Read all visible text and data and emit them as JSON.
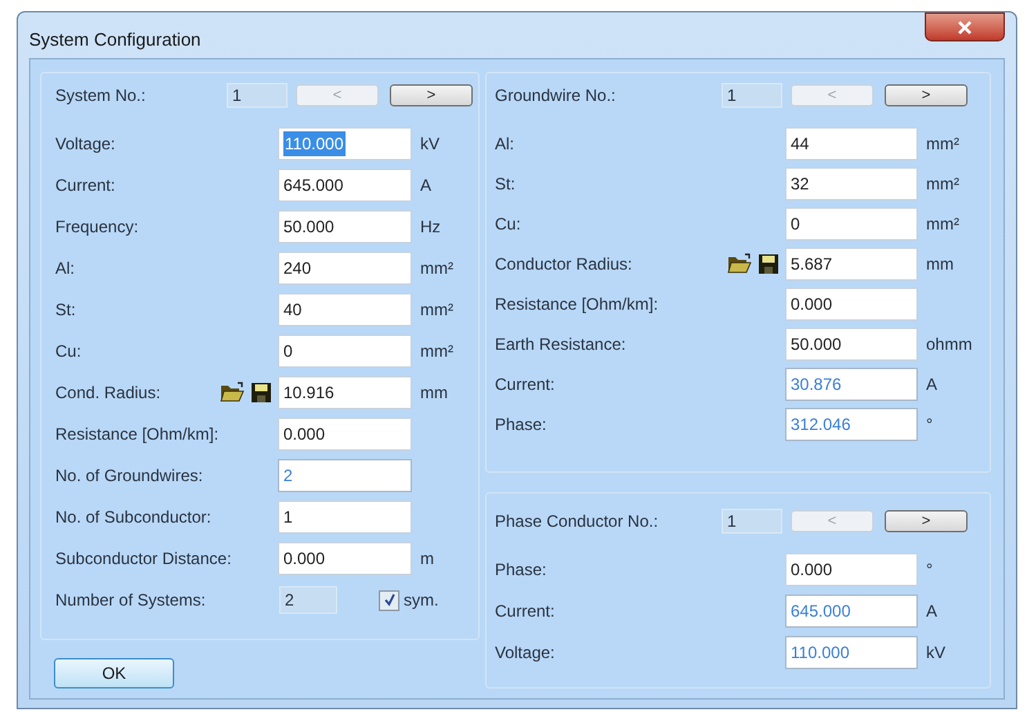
{
  "window": {
    "title": "System Configuration"
  },
  "system": {
    "label": "System No.:",
    "value": "1",
    "prev": "<",
    "next": ">"
  },
  "system_fields": [
    {
      "kind": "input",
      "label": "Voltage:",
      "value": "110.000",
      "unit": "kV",
      "computed": false,
      "selected": true
    },
    {
      "kind": "input",
      "label": "Current:",
      "value": "645.000",
      "unit": "A",
      "computed": false,
      "selected": false
    },
    {
      "kind": "input",
      "label": "Frequency:",
      "value": "50.000",
      "unit": "Hz",
      "computed": false,
      "selected": false
    },
    {
      "kind": "input",
      "label": "Al:",
      "value": "240",
      "unit": "mm²",
      "computed": false,
      "selected": false
    },
    {
      "kind": "input",
      "label": "St:",
      "value": "40",
      "unit": "mm²",
      "computed": false,
      "selected": false
    },
    {
      "kind": "input",
      "label": "Cu:",
      "value": "0",
      "unit": "mm²",
      "computed": false,
      "selected": false
    },
    {
      "kind": "file_input",
      "label": "Cond. Radius:",
      "value": "10.916",
      "unit": "mm",
      "computed": false,
      "selected": false
    },
    {
      "kind": "input",
      "label": "Resistance [Ohm/km]:",
      "value": "0.000",
      "computed": false,
      "selected": false
    },
    {
      "kind": "input",
      "label": "No. of Groundwires:",
      "value": "2",
      "computed": true,
      "selected": false
    },
    {
      "kind": "input",
      "label": "No. of Subconductor:",
      "value": "1",
      "computed": false,
      "selected": false
    },
    {
      "kind": "input",
      "label": "Subconductor Distance:",
      "value": "0.000",
      "unit": "m",
      "computed": false,
      "selected": false
    }
  ],
  "number_of_systems": {
    "label": "Number of Systems:",
    "value": "2"
  },
  "sym": {
    "label": "sym.",
    "checked": true
  },
  "ok_button": "OK",
  "groundwire": {
    "label": "Groundwire No.:",
    "value": "1",
    "prev": "<",
    "next": ">"
  },
  "groundwire_fields": [
    {
      "kind": "input",
      "label": "Al:",
      "value": "44",
      "unit": "mm²",
      "computed": false,
      "selected": false
    },
    {
      "kind": "input",
      "label": "St:",
      "value": "32",
      "unit": "mm²",
      "computed": false,
      "selected": false
    },
    {
      "kind": "input",
      "label": "Cu:",
      "value": "0",
      "unit": "mm²",
      "computed": false,
      "selected": false
    },
    {
      "kind": "file_input",
      "label": "Conductor Radius:",
      "value": "5.687",
      "unit": "mm",
      "computed": false,
      "selected": false
    },
    {
      "kind": "input",
      "label": "Resistance [Ohm/km]:",
      "value": "0.000",
      "computed": false,
      "selected": false
    },
    {
      "kind": "input",
      "label": "Earth Resistance:",
      "value": "50.000",
      "unit": "ohmm",
      "computed": false,
      "selected": false
    },
    {
      "kind": "input",
      "label": "Current:",
      "value": "30.876",
      "unit": "A",
      "computed": true,
      "selected": false
    },
    {
      "kind": "input",
      "label": "Phase:",
      "value": "312.046",
      "unit": "°",
      "computed": true,
      "selected": false
    }
  ],
  "phase_conductor": {
    "label": "Phase Conductor No.:",
    "value": "1",
    "prev": "<",
    "next": ">"
  },
  "phase_conductor_fields": [
    {
      "kind": "input",
      "label": "Phase:",
      "value": "0.000",
      "unit": "°",
      "computed": false,
      "selected": false
    },
    {
      "kind": "input",
      "label": "Current:",
      "value": "645.000",
      "unit": "A",
      "computed": true,
      "selected": false
    },
    {
      "kind": "input",
      "label": "Voltage:",
      "value": "110.000",
      "unit": "kV",
      "computed": true,
      "selected": false
    }
  ]
}
